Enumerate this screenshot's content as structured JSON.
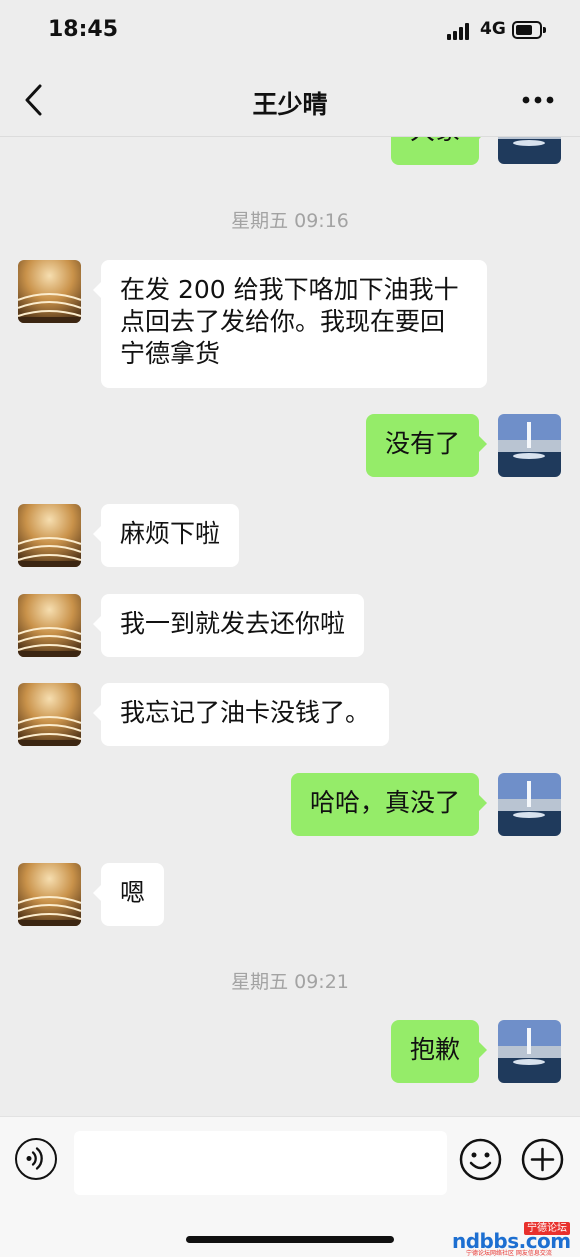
{
  "status_bar": {
    "time": "18:45",
    "network": "4G"
  },
  "nav": {
    "title": "王少晴"
  },
  "icons": {
    "back": "chevron-left-icon",
    "more": "more-dots-icon",
    "voice": "voice-icon",
    "emoji": "emoji-icon",
    "plus": "plus-icon"
  },
  "colors": {
    "my_bubble": "#95ec69",
    "their_bubble": "#ffffff",
    "background": "#ededed"
  },
  "messages": [
    {
      "from": "me",
      "text": "大象",
      "clipped": true
    },
    {
      "type": "timestamp",
      "text": "星期五 09:16"
    },
    {
      "from": "them",
      "text": "在发 200 给我下咯加下油我十点回去了发给你。我现在要回宁德拿货"
    },
    {
      "from": "me",
      "text": "没有了"
    },
    {
      "from": "them",
      "text": "麻烦下啦"
    },
    {
      "from": "them",
      "text": "我一到就发去还你啦"
    },
    {
      "from": "them",
      "text": "我忘记了油卡没钱了。"
    },
    {
      "from": "me",
      "text": "哈哈，真没了"
    },
    {
      "from": "them",
      "text": "嗯"
    },
    {
      "type": "timestamp",
      "text": "星期五 09:21"
    },
    {
      "from": "me",
      "text": "抱歉"
    }
  ],
  "input": {
    "placeholder": ""
  },
  "watermark": {
    "text": "ndbbs.com",
    "badge": "宁德论坛",
    "tagline": "宁德论坛网络社区 网友信息交流"
  }
}
